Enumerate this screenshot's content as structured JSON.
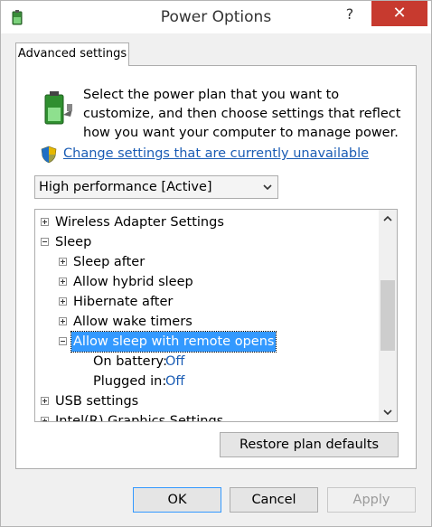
{
  "window": {
    "title": "Power Options",
    "help_label": "?",
    "close_label": "✕"
  },
  "tab": {
    "label": "Advanced settings"
  },
  "description": "Select the power plan that you want to customize, and then choose settings that reflect how you want your computer to manage power.",
  "change_link": "Change settings that are currently unavailable",
  "plan_select": {
    "value": "High performance [Active]"
  },
  "tree": {
    "rows": [
      {
        "label": "Wireless Adapter Settings",
        "level": 0,
        "expander": "plus"
      },
      {
        "label": "Sleep",
        "level": 0,
        "expander": "minus"
      },
      {
        "label": "Sleep after",
        "level": 1,
        "expander": "plus"
      },
      {
        "label": "Allow hybrid sleep",
        "level": 1,
        "expander": "plus"
      },
      {
        "label": "Hibernate after",
        "level": 1,
        "expander": "plus"
      },
      {
        "label": "Allow wake timers",
        "level": 1,
        "expander": "plus"
      },
      {
        "label": "Allow sleep with remote opens",
        "level": 1,
        "expander": "minus",
        "selected": true
      },
      {
        "label": "On battery:",
        "value": "Off",
        "level": 2
      },
      {
        "label": "Plugged in:",
        "value": "Off",
        "level": 2
      },
      {
        "label": "USB settings",
        "level": 0,
        "expander": "plus"
      },
      {
        "label": "Intel(R) Graphics Settings",
        "level": 0,
        "expander": "plus"
      }
    ]
  },
  "buttons": {
    "restore": "Restore plan defaults",
    "ok": "OK",
    "cancel": "Cancel",
    "apply": "Apply"
  },
  "colors": {
    "accent": "#3399ff",
    "link": "#1a5cb4",
    "close": "#c73a2f"
  }
}
